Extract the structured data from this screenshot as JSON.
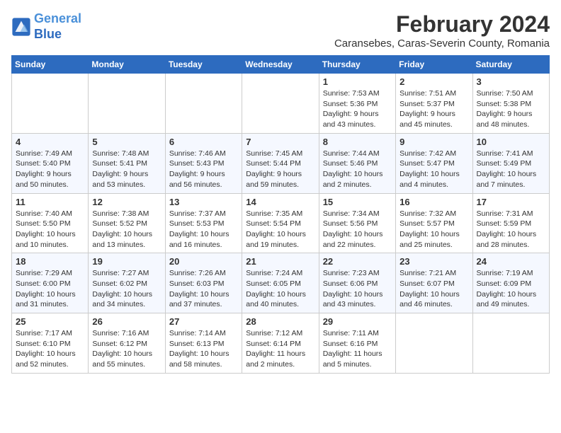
{
  "header": {
    "logo_line1": "General",
    "logo_line2": "Blue",
    "title": "February 2024",
    "subtitle": "Caransebes, Caras-Severin County, Romania"
  },
  "weekdays": [
    "Sunday",
    "Monday",
    "Tuesday",
    "Wednesday",
    "Thursday",
    "Friday",
    "Saturday"
  ],
  "weeks": [
    [
      {
        "day": "",
        "info": ""
      },
      {
        "day": "",
        "info": ""
      },
      {
        "day": "",
        "info": ""
      },
      {
        "day": "",
        "info": ""
      },
      {
        "day": "1",
        "info": "Sunrise: 7:53 AM\nSunset: 5:36 PM\nDaylight: 9 hours\nand 43 minutes."
      },
      {
        "day": "2",
        "info": "Sunrise: 7:51 AM\nSunset: 5:37 PM\nDaylight: 9 hours\nand 45 minutes."
      },
      {
        "day": "3",
        "info": "Sunrise: 7:50 AM\nSunset: 5:38 PM\nDaylight: 9 hours\nand 48 minutes."
      }
    ],
    [
      {
        "day": "4",
        "info": "Sunrise: 7:49 AM\nSunset: 5:40 PM\nDaylight: 9 hours\nand 50 minutes."
      },
      {
        "day": "5",
        "info": "Sunrise: 7:48 AM\nSunset: 5:41 PM\nDaylight: 9 hours\nand 53 minutes."
      },
      {
        "day": "6",
        "info": "Sunrise: 7:46 AM\nSunset: 5:43 PM\nDaylight: 9 hours\nand 56 minutes."
      },
      {
        "day": "7",
        "info": "Sunrise: 7:45 AM\nSunset: 5:44 PM\nDaylight: 9 hours\nand 59 minutes."
      },
      {
        "day": "8",
        "info": "Sunrise: 7:44 AM\nSunset: 5:46 PM\nDaylight: 10 hours\nand 2 minutes."
      },
      {
        "day": "9",
        "info": "Sunrise: 7:42 AM\nSunset: 5:47 PM\nDaylight: 10 hours\nand 4 minutes."
      },
      {
        "day": "10",
        "info": "Sunrise: 7:41 AM\nSunset: 5:49 PM\nDaylight: 10 hours\nand 7 minutes."
      }
    ],
    [
      {
        "day": "11",
        "info": "Sunrise: 7:40 AM\nSunset: 5:50 PM\nDaylight: 10 hours\nand 10 minutes."
      },
      {
        "day": "12",
        "info": "Sunrise: 7:38 AM\nSunset: 5:52 PM\nDaylight: 10 hours\nand 13 minutes."
      },
      {
        "day": "13",
        "info": "Sunrise: 7:37 AM\nSunset: 5:53 PM\nDaylight: 10 hours\nand 16 minutes."
      },
      {
        "day": "14",
        "info": "Sunrise: 7:35 AM\nSunset: 5:54 PM\nDaylight: 10 hours\nand 19 minutes."
      },
      {
        "day": "15",
        "info": "Sunrise: 7:34 AM\nSunset: 5:56 PM\nDaylight: 10 hours\nand 22 minutes."
      },
      {
        "day": "16",
        "info": "Sunrise: 7:32 AM\nSunset: 5:57 PM\nDaylight: 10 hours\nand 25 minutes."
      },
      {
        "day": "17",
        "info": "Sunrise: 7:31 AM\nSunset: 5:59 PM\nDaylight: 10 hours\nand 28 minutes."
      }
    ],
    [
      {
        "day": "18",
        "info": "Sunrise: 7:29 AM\nSunset: 6:00 PM\nDaylight: 10 hours\nand 31 minutes."
      },
      {
        "day": "19",
        "info": "Sunrise: 7:27 AM\nSunset: 6:02 PM\nDaylight: 10 hours\nand 34 minutes."
      },
      {
        "day": "20",
        "info": "Sunrise: 7:26 AM\nSunset: 6:03 PM\nDaylight: 10 hours\nand 37 minutes."
      },
      {
        "day": "21",
        "info": "Sunrise: 7:24 AM\nSunset: 6:05 PM\nDaylight: 10 hours\nand 40 minutes."
      },
      {
        "day": "22",
        "info": "Sunrise: 7:23 AM\nSunset: 6:06 PM\nDaylight: 10 hours\nand 43 minutes."
      },
      {
        "day": "23",
        "info": "Sunrise: 7:21 AM\nSunset: 6:07 PM\nDaylight: 10 hours\nand 46 minutes."
      },
      {
        "day": "24",
        "info": "Sunrise: 7:19 AM\nSunset: 6:09 PM\nDaylight: 10 hours\nand 49 minutes."
      }
    ],
    [
      {
        "day": "25",
        "info": "Sunrise: 7:17 AM\nSunset: 6:10 PM\nDaylight: 10 hours\nand 52 minutes."
      },
      {
        "day": "26",
        "info": "Sunrise: 7:16 AM\nSunset: 6:12 PM\nDaylight: 10 hours\nand 55 minutes."
      },
      {
        "day": "27",
        "info": "Sunrise: 7:14 AM\nSunset: 6:13 PM\nDaylight: 10 hours\nand 58 minutes."
      },
      {
        "day": "28",
        "info": "Sunrise: 7:12 AM\nSunset: 6:14 PM\nDaylight: 11 hours\nand 2 minutes."
      },
      {
        "day": "29",
        "info": "Sunrise: 7:11 AM\nSunset: 6:16 PM\nDaylight: 11 hours\nand 5 minutes."
      },
      {
        "day": "",
        "info": ""
      },
      {
        "day": "",
        "info": ""
      }
    ]
  ]
}
